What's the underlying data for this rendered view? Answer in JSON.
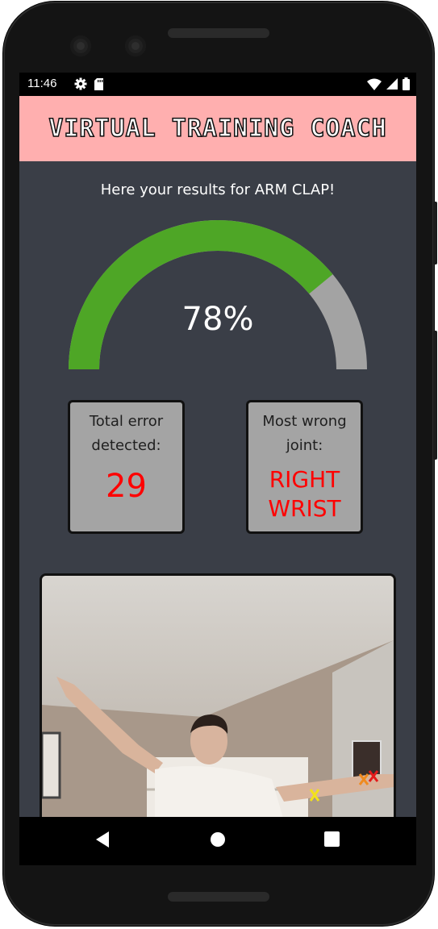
{
  "status_bar": {
    "time": "11:46",
    "left_icons": [
      "settings-icon",
      "sd-card-icon"
    ],
    "right_icons": [
      "wifi-icon",
      "cell-signal-icon",
      "battery-icon"
    ]
  },
  "app": {
    "title": "Virtual Training Coach",
    "header_color": "#ffafaf",
    "background_color": "#3a3e47"
  },
  "results": {
    "intro_text": "Here your results for ARM CLAP!",
    "score_label": "78%",
    "score_fraction": 0.78,
    "gauge_fill_color": "#4ea626",
    "gauge_track_color": "#a3a3a3"
  },
  "stats": {
    "errors": {
      "label": "Total error detected:",
      "value": "29"
    },
    "joint": {
      "label": "Most wrong joint:",
      "value": "RIGHT WRIST"
    },
    "value_color": "#ff0000"
  },
  "video": {
    "marker_icons": [
      "yellow-x-marker",
      "orange-x-marker",
      "red-x-marker"
    ]
  },
  "nav_bar": {
    "icons": [
      "back-triangle-icon",
      "home-circle-icon",
      "recents-square-icon"
    ]
  }
}
